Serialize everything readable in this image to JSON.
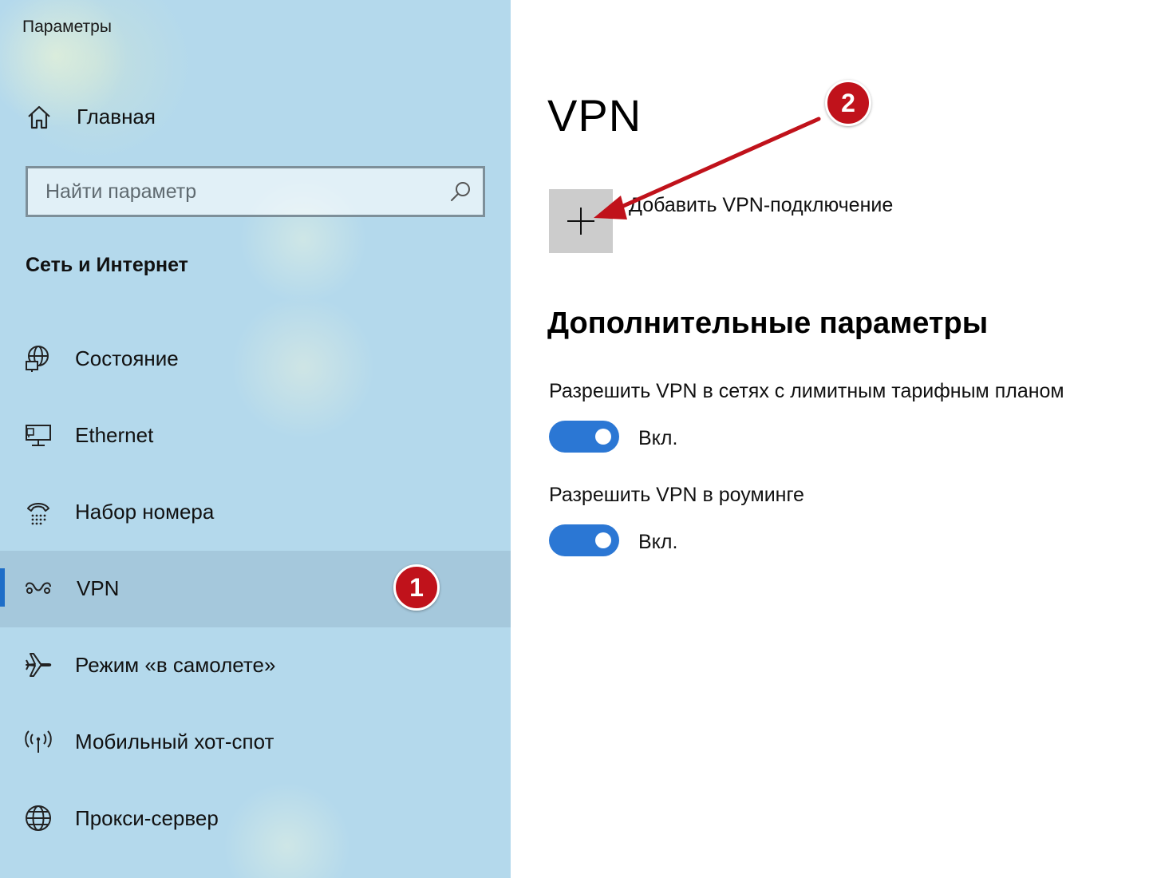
{
  "window": {
    "title": "Параметры"
  },
  "sidebar": {
    "home_label": "Главная",
    "search": {
      "placeholder": "Найти параметр",
      "value": ""
    },
    "section_title": "Сеть и Интернет",
    "items": [
      {
        "label": "Состояние",
        "icon": "globe-network-icon",
        "selected": false
      },
      {
        "label": "Ethernet",
        "icon": "ethernet-monitor-icon",
        "selected": false
      },
      {
        "label": "Набор номера",
        "icon": "dialup-phone-icon",
        "selected": false
      },
      {
        "label": "VPN",
        "icon": "vpn-icon",
        "selected": true
      },
      {
        "label": "Режим «в самолете»",
        "icon": "airplane-icon",
        "selected": false
      },
      {
        "label": "Мобильный хот-спот",
        "icon": "hotspot-icon",
        "selected": false
      },
      {
        "label": "Прокси-сервер",
        "icon": "globe-icon",
        "selected": false
      }
    ]
  },
  "main": {
    "title": "VPN",
    "add_vpn_label": "Добавить VPN-подключение",
    "advanced_title": "Дополнительные параметры",
    "settings": [
      {
        "label": "Разрешить VPN в сетях с лимитным тарифным планом",
        "state": "Вкл.",
        "on": true
      },
      {
        "label": "Разрешить VPN в роуминге",
        "state": "Вкл.",
        "on": true
      }
    ]
  },
  "annotations": {
    "badge_1": "1",
    "badge_2": "2",
    "badge_color": "#c0121b"
  },
  "colors": {
    "sidebar_bg": "#b4d9ec",
    "accent": "#1e6ec8",
    "toggle_on": "#2b77d4",
    "add_tile": "#cccccc"
  }
}
